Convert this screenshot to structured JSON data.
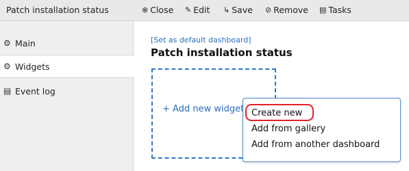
{
  "header": {
    "title": "Patch installation status",
    "toolbar": [
      {
        "label": "Close",
        "icon": "close-icon"
      },
      {
        "label": "Edit",
        "icon": "pencil-icon"
      },
      {
        "label": "Save",
        "icon": "save-icon"
      },
      {
        "label": "Remove",
        "icon": "remove-icon"
      },
      {
        "label": "Tasks",
        "icon": "tasks-icon"
      }
    ]
  },
  "sidebar": {
    "items": [
      {
        "label": "Main",
        "icon": "gears-icon"
      },
      {
        "label": "Widgets",
        "icon": "gears-icon",
        "selected": true
      },
      {
        "label": "Event log",
        "icon": "log-icon"
      }
    ]
  },
  "main": {
    "default_link": "[Set as default dashboard]",
    "title": "Patch installation status",
    "add_widget": "+ Add new widget"
  },
  "menu": {
    "items": [
      {
        "label": "Create new"
      },
      {
        "label": "Add from gallery"
      },
      {
        "label": "Add from another dashboard"
      }
    ]
  },
  "colors": {
    "accent": "#2a6cc0",
    "highlight": "#e0202a",
    "toolbar_bg": "#e9e9e9",
    "sidebar_bg": "#efefef"
  }
}
